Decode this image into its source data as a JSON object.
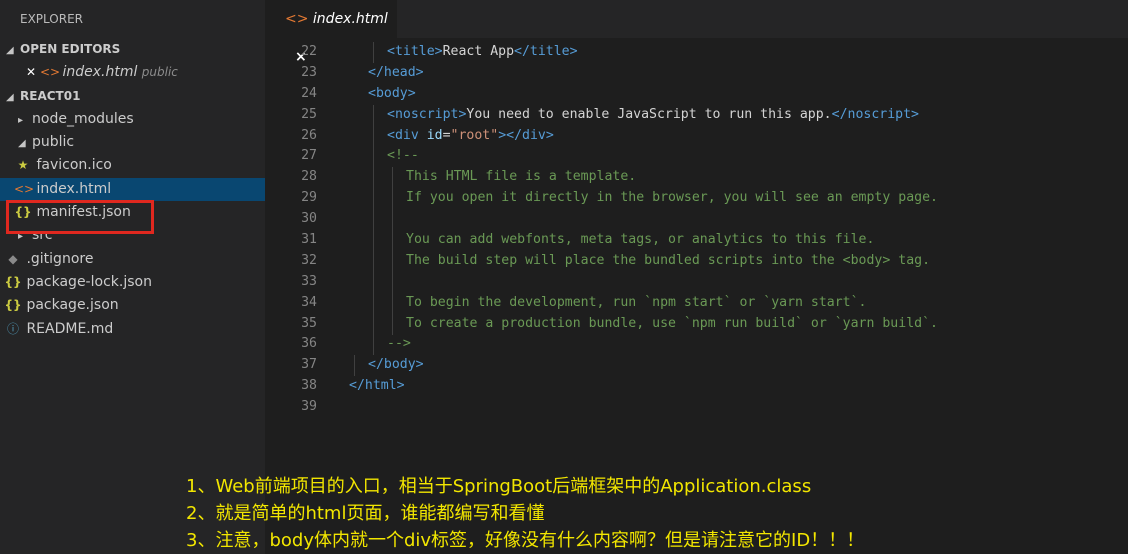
{
  "sidebar": {
    "title": "EXPLORER",
    "open_editors": {
      "label": "OPEN EDITORS",
      "items": [
        {
          "name": "index.html",
          "folder": "public"
        }
      ]
    },
    "project": {
      "label": "REACT01"
    },
    "tree": {
      "node_modules": "node_modules",
      "public": "public",
      "favicon": "favicon.ico",
      "index": "index.html",
      "manifest": "manifest.json",
      "src": "src",
      "gitignore": ".gitignore",
      "package_lock": "package-lock.json",
      "package": "package.json",
      "readme": "README.md"
    }
  },
  "tab": {
    "label": "index.html",
    "close": "×"
  },
  "editor": {
    "lines": [
      {
        "n": "22"
      },
      {
        "n": "23"
      },
      {
        "n": "24"
      },
      {
        "n": "25"
      },
      {
        "n": "26"
      },
      {
        "n": "27"
      },
      {
        "n": "28"
      },
      {
        "n": "29"
      },
      {
        "n": "30"
      },
      {
        "n": "31"
      },
      {
        "n": "32"
      },
      {
        "n": "33"
      },
      {
        "n": "34"
      },
      {
        "n": "35"
      },
      {
        "n": "36"
      },
      {
        "n": "37"
      },
      {
        "n": "38"
      },
      {
        "n": "39"
      }
    ],
    "code": {
      "l22_open": "<title>",
      "l22_text": "React App",
      "l22_close": "</title>",
      "l23": "</head>",
      "l24": "<body>",
      "l25_open": "<noscript>",
      "l25_text": "You need to enable JavaScript to run this app.",
      "l25_close": "</noscript>",
      "l26_a": "<div ",
      "l26_attr": "id",
      "l26_eq": "=",
      "l26_val": "\"root\"",
      "l26_b": "></div>",
      "l27": "<!--",
      "l28": "This HTML file is a template.",
      "l29": "If you open it directly in the browser, you will see an empty page.",
      "l31": "You can add webfonts, meta tags, or analytics to this file.",
      "l32": "The build step will place the bundled scripts into the <body> tag.",
      "l34": "To begin the development, run `npm start` or `yarn start`.",
      "l35": "To create a production bundle, use `npm run build` or `yarn build`.",
      "l36": "-->",
      "l37": "</body>",
      "l38": "</html>"
    }
  },
  "notes": [
    "1、Web前端项目的入口，相当于SpringBoot后端框架中的Application.class",
    "2、就是简单的html页面，谁能都编写和看懂",
    "3、注意，body体内就一个div标签，好像没有什么内容啊？但是请注意它的ID！！！"
  ],
  "colors": {
    "accent_selected": "#094771",
    "highlight_box": "#e0281f",
    "note_text": "#f2e600"
  }
}
